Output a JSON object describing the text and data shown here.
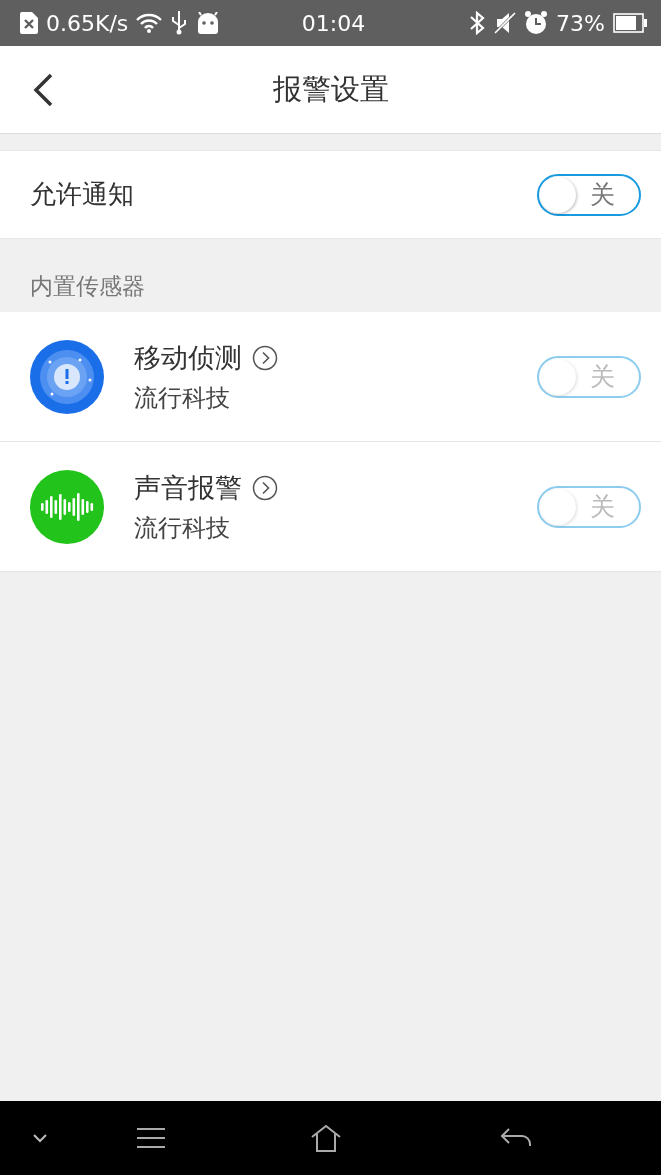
{
  "status_bar": {
    "speed": "0.65K/s",
    "time": "01:04",
    "battery": "73%"
  },
  "header": {
    "title": "报警设置"
  },
  "notify": {
    "label": "允许通知",
    "on": false,
    "switch_text": "关",
    "disabled": false
  },
  "section": {
    "title": "内置传感器"
  },
  "sensors": [
    {
      "kind": "motion",
      "name": "移动侦测",
      "vendor": "流行科技",
      "on": false,
      "switch_text": "关",
      "disabled": true
    },
    {
      "kind": "sound",
      "name": "声音报警",
      "vendor": "流行科技",
      "on": false,
      "switch_text": "关",
      "disabled": true
    }
  ]
}
